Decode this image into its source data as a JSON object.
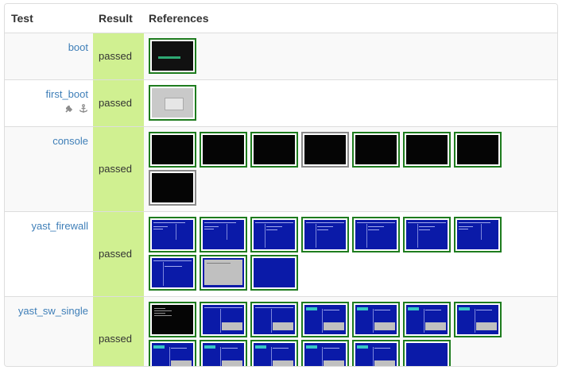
{
  "table": {
    "headers": {
      "test": "Test",
      "result": "Result",
      "references": "References"
    },
    "rows": [
      {
        "test": "boot",
        "result": "passed",
        "has_icons": false,
        "thumbs": [
          {
            "style": "boot",
            "border": "green"
          }
        ]
      },
      {
        "test": "first_boot",
        "result": "passed",
        "has_icons": true,
        "icons": [
          "plug-icon",
          "anchor-icon"
        ],
        "thumbs": [
          {
            "style": "greydlg",
            "border": "green"
          }
        ]
      },
      {
        "test": "console",
        "result": "passed",
        "has_icons": false,
        "thumbs": [
          {
            "style": "black",
            "border": "green"
          },
          {
            "style": "black",
            "border": "green"
          },
          {
            "style": "black",
            "border": "green"
          },
          {
            "style": "black",
            "border": "grey"
          },
          {
            "style": "black",
            "border": "green"
          },
          {
            "style": "black",
            "border": "green"
          },
          {
            "style": "black",
            "border": "green"
          },
          {
            "style": "black",
            "border": "grey"
          }
        ]
      },
      {
        "test": "yast_firewall",
        "result": "passed",
        "has_icons": false,
        "thumbs": [
          {
            "style": "blue-a",
            "border": "green"
          },
          {
            "style": "blue-a",
            "border": "green"
          },
          {
            "style": "blue-b",
            "border": "green"
          },
          {
            "style": "blue-b",
            "border": "green"
          },
          {
            "style": "blue-b",
            "border": "green"
          },
          {
            "style": "blue-b",
            "border": "green"
          },
          {
            "style": "blue-a",
            "border": "green"
          },
          {
            "style": "blue-c",
            "border": "green"
          },
          {
            "style": "grey-dlg",
            "border": "green"
          },
          {
            "style": "blue-plain",
            "border": "green"
          }
        ]
      },
      {
        "test": "yast_sw_single",
        "result": "passed",
        "has_icons": false,
        "thumbs": [
          {
            "style": "black-text",
            "border": "green"
          },
          {
            "style": "blue-sw",
            "border": "green"
          },
          {
            "style": "blue-sw",
            "border": "green"
          },
          {
            "style": "blue-sw-hl",
            "border": "green"
          },
          {
            "style": "blue-sw-hl",
            "border": "green"
          },
          {
            "style": "blue-sw-hl",
            "border": "green"
          },
          {
            "style": "blue-sw-hl",
            "border": "green"
          },
          {
            "style": "blue-sw-hl",
            "border": "green"
          },
          {
            "style": "blue-sw-hl",
            "border": "green"
          },
          {
            "style": "blue-sw-hl",
            "border": "green"
          },
          {
            "style": "blue-sw-hl",
            "border": "green"
          },
          {
            "style": "blue-sw-hl",
            "border": "green"
          },
          {
            "style": "blue-plain",
            "border": "green"
          }
        ]
      }
    ]
  },
  "colors": {
    "link": "#3f7fb8",
    "result_bg": "#d0f091",
    "thumb_border_ok": "#1e7c1e",
    "thumb_border_grey": "#8a8a8a"
  }
}
